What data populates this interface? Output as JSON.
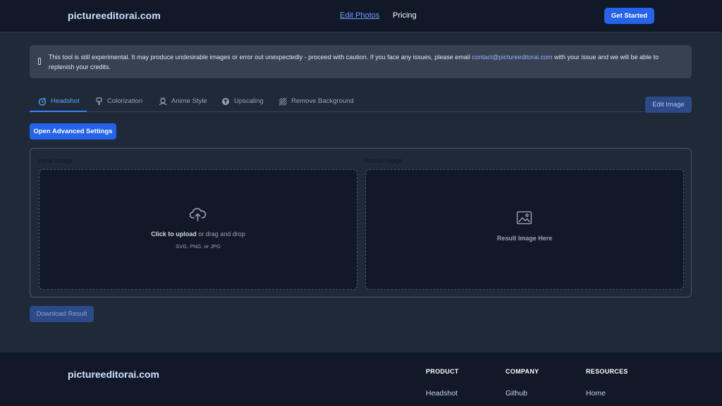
{
  "header": {
    "logo": "pictureeditorai.com",
    "nav": {
      "edit_photos": "Edit Photos",
      "pricing": "Pricing"
    },
    "cta": "Get Started"
  },
  "notice": {
    "text_before": "This tool is still experimental. It may produce undesirable images or error out unexpectedly - proceed with caution. If you face any issues, please email ",
    "email": "contact@pictureeditorai.com",
    "text_after": " with your issue and we will be able to replenish your credits."
  },
  "tabs": [
    {
      "label": "Headshot",
      "icon": "headshot-icon",
      "active": true
    },
    {
      "label": "Colorization",
      "icon": "brush-icon",
      "active": false
    },
    {
      "label": "Anime Style",
      "icon": "anime-icon",
      "active": false
    },
    {
      "label": "Upscaling",
      "icon": "upscale-icon",
      "active": false
    },
    {
      "label": "Remove Background",
      "icon": "remove-background-icon",
      "active": false
    }
  ],
  "actions": {
    "edit_image": "Edit Image",
    "advanced_settings": "Open Advanced Settings",
    "download": "Download Result"
  },
  "input": {
    "label": "Input Image",
    "upload_bold": "Click to upload",
    "upload_rest": " or drag and drop",
    "formats": "SVG, PNG, or JPG"
  },
  "result": {
    "label": "Result Image",
    "placeholder": "Result Image Here"
  },
  "footer": {
    "logo": "pictureeditorai.com",
    "columns": [
      {
        "heading": "PRODUCT",
        "link": "Headshot"
      },
      {
        "heading": "COMPANY",
        "link": "Github"
      },
      {
        "heading": "RESOURCES",
        "link": "Home"
      }
    ]
  },
  "colors": {
    "accent": "#2563eb",
    "link": "#6e9bff",
    "background": "#1f2937",
    "header": "#111827"
  }
}
